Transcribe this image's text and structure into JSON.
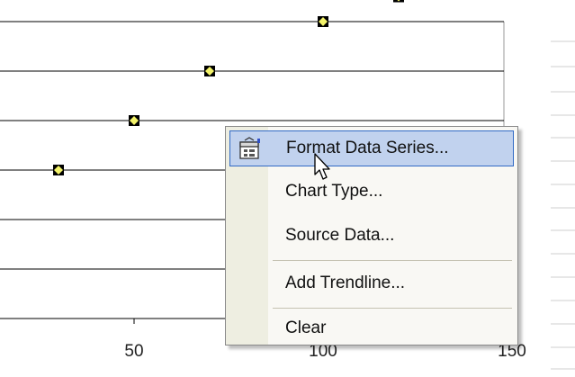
{
  "chart_data": {
    "type": "scatter",
    "title": "",
    "xlabel": "",
    "ylabel": "",
    "x_ticks": [
      "50",
      "100",
      "150"
    ],
    "xlim": [
      0,
      150
    ],
    "ylim": [
      0,
      7
    ],
    "grid": true,
    "series": [
      {
        "marker": "diamond-square",
        "marker_color": "#f3f36a",
        "points": [
          {
            "x": 30,
            "y": 3
          },
          {
            "x": 50,
            "y": 4
          },
          {
            "x": 70,
            "y": 5
          },
          {
            "x": 100,
            "y": 6
          },
          {
            "x": 120,
            "y": 6.5
          }
        ]
      }
    ]
  },
  "context_menu": {
    "items": [
      {
        "label": "Format Data Series...",
        "highlighted": true,
        "icon": "format-properties-icon"
      },
      {
        "label": "Chart Type..."
      },
      {
        "label": "Source Data..."
      },
      {
        "label": "Add Trendline..."
      },
      {
        "label": "Clear"
      }
    ]
  },
  "colors": {
    "menu_highlight": "#c1d2ee",
    "menu_highlight_border": "#316ac5",
    "menu_gutter": "#eeeee1",
    "gridline": "#000000"
  }
}
